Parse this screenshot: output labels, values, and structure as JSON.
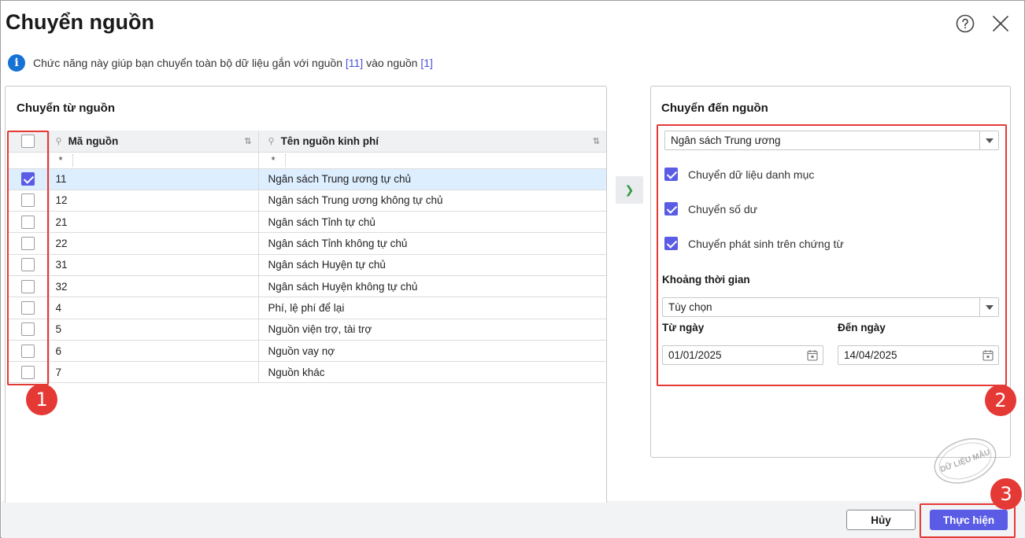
{
  "dialog": {
    "title": "Chuyển nguồn"
  },
  "info": {
    "text_before": "Chức năng này giúp bạn chuyển toàn bộ dữ liệu gắn với nguồn ",
    "source_from": "[11]",
    "text_middle": " vào nguồn ",
    "source_to": "[1]"
  },
  "left_panel": {
    "title": "Chuyển từ nguồn",
    "columns": {
      "code": "Mã nguồn",
      "name": "Tên nguồn kinh phí"
    },
    "filter_placeholder": "*",
    "rows": [
      {
        "code": "11",
        "name": "Ngân sách Trung ương tự chủ",
        "checked": true
      },
      {
        "code": "12",
        "name": "Ngân sách Trung ương không tự chủ",
        "checked": false
      },
      {
        "code": "21",
        "name": "Ngân sách Tỉnh tự chủ",
        "checked": false
      },
      {
        "code": "22",
        "name": "Ngân sách Tỉnh không tự chủ",
        "checked": false
      },
      {
        "code": "31",
        "name": "Ngân sách Huyện tự chủ",
        "checked": false
      },
      {
        "code": "32",
        "name": "Ngân sách Huyện không tự chủ",
        "checked": false
      },
      {
        "code": "4",
        "name": "Phí, lệ phí để lại",
        "checked": false
      },
      {
        "code": "5",
        "name": "Nguồn viện trợ, tài trợ",
        "checked": false
      },
      {
        "code": "6",
        "name": "Nguồn vay nợ",
        "checked": false
      },
      {
        "code": "7",
        "name": "Nguồn khác",
        "checked": false
      }
    ]
  },
  "move_button": {
    "icon": "chevron-right-icon"
  },
  "right_panel": {
    "title": "Chuyển đến nguồn",
    "target_source": "Ngân sách Trung ương",
    "options": [
      {
        "label": "Chuyển dữ liệu danh mục",
        "checked": true
      },
      {
        "label": "Chuyển số dư",
        "checked": true
      },
      {
        "label": "Chuyển phát sinh trên chứng từ",
        "checked": true
      }
    ],
    "period_label": "Khoảng thời gian",
    "period_value": "Tùy chọn",
    "from_label": "Từ ngày",
    "from_value": "01/01/2025",
    "to_label": "Đến ngày",
    "to_value": "14/04/2025"
  },
  "footer": {
    "cancel_label": "Hủy",
    "ok_label": "Thực hiện"
  },
  "annotations": {
    "badge1": "1",
    "badge2": "2",
    "badge3": "3"
  },
  "watermark": "DỮ LIỆU MẪU",
  "colors": {
    "accent": "#5a5ce6",
    "annotation": "#e53935",
    "info": "#1672d4",
    "selected_row": "#ddeeff"
  }
}
